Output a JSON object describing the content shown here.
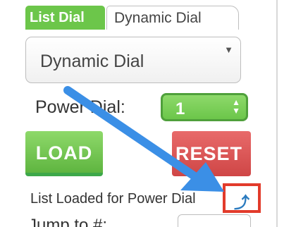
{
  "tabs": [
    {
      "label": "List Dial",
      "active": true
    },
    {
      "label": "Dynamic Dial",
      "active": false
    }
  ],
  "dial_select": {
    "value": "Dynamic Dial"
  },
  "power_dial": {
    "label": "Power Dial:",
    "value": "1"
  },
  "buttons": {
    "load": "LOAD",
    "reset": "RESET"
  },
  "status": {
    "text": "List Loaded for Power Dial"
  },
  "jump": {
    "label": "Jump to #:"
  },
  "colors": {
    "tab_active": "#6cc64a",
    "load_button": "#6cc64a",
    "reset_button": "#d9534f",
    "annotation_arrow": "#3b8fe6",
    "highlight_box": "#e23b2b"
  },
  "icons": {
    "dial_caret": "caret-down-icon",
    "stepper": "updown-stepper-icon",
    "status_icon": "curved-arrow-up-icon"
  }
}
